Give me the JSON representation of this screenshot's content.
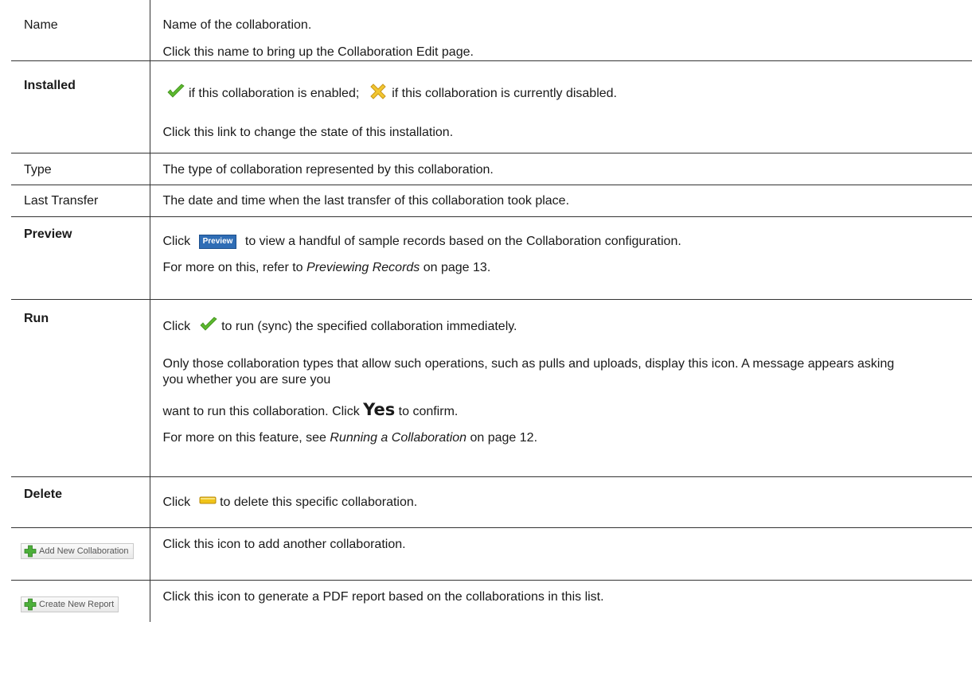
{
  "rows": {
    "name": {
      "label": "Name",
      "desc1": "Name of the collaboration.",
      "desc2": "Click this name to bring up the Collaboration Edit page."
    },
    "installed": {
      "label": "Installed",
      "icon_enabled": "green-check-icon",
      "icon_disabled": "yellow-x-icon",
      "desc1a": " if this collaboration is enabled;",
      "desc1b": " if this collaboration is currently disabled.",
      "desc2": "Click this link to change the state of this installation."
    },
    "type": {
      "label": "Type",
      "desc": "The type of collaboration represented by this collaboration."
    },
    "last_transfer": {
      "label": "Last Transfer",
      "desc": "The date and time when the last transfer of this collaboration took place."
    },
    "preview": {
      "label": "Preview",
      "click": "Click",
      "button_label": "Preview",
      "desc1": "to view a handful of sample records based on the Collaboration configuration.",
      "desc2_pre": "For more on this, refer to ",
      "desc2_link": "Previewing Records",
      "desc2_post": " on page 13."
    },
    "run": {
      "label": "Run",
      "click": "Click",
      "icon": "green-check-icon",
      "desc1": " to run (sync) the specified collaboration immediately.",
      "desc2": "Only those collaboration types that allow such operations, such as pulls and uploads, display this icon. A message appears asking you whether you are sure you",
      "desc3_pre": "want to run this collaboration. Click ",
      "desc3_yes": "Yes",
      "desc3_post": " to confirm.",
      "desc4_pre": "For more on this feature, see ",
      "desc4_link": "Running a Collaboration",
      "desc4_post": " on page 12."
    },
    "delete": {
      "label": "Delete",
      "click": "Click",
      "icon": "minus-icon",
      "desc": " to delete this specific collaboration."
    },
    "add_new": {
      "button_label": "Add New Collaboration",
      "icon": "green-plus-icon",
      "desc": "Click this icon to add another collaboration."
    },
    "create_report": {
      "button_label": "Create New Report",
      "icon": "green-plus-icon",
      "desc": "Click this icon to generate a PDF report based on the collaborations in this list."
    }
  },
  "colors": {
    "check_green": "#5cb82e",
    "x_yellow": "#f2c630",
    "minus_yellow": "#f0c419",
    "preview_blue": "#2f6db5",
    "plus_green": "#4caf3a",
    "border": "#333333"
  }
}
